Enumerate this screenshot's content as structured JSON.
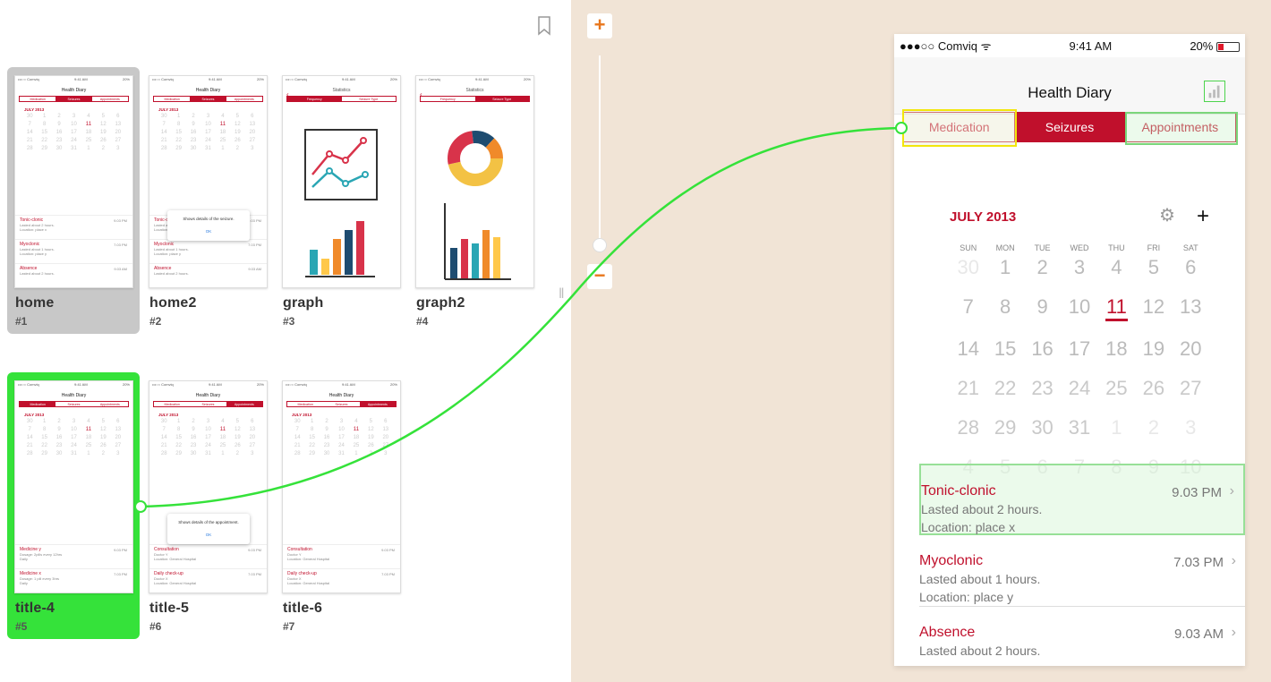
{
  "screens": [
    {
      "title": "home",
      "num": "#1"
    },
    {
      "title": "home2",
      "num": "#2"
    },
    {
      "title": "graph",
      "num": "#3"
    },
    {
      "title": "graph2",
      "num": "#4"
    },
    {
      "title": "title-4",
      "num": "#5"
    },
    {
      "title": "title-5",
      "num": "#6"
    },
    {
      "title": "title-6",
      "num": "#7"
    }
  ],
  "mini": {
    "carrier": "•••○○ Comviq",
    "time": "9:41 AM",
    "battery": "20%",
    "app_title": "Health Diary",
    "stats_title": "Statistics",
    "tabs": [
      "Medication",
      "Seizures",
      "Appointments"
    ],
    "stat_tabs": [
      "Frequency",
      "Seizure Type"
    ],
    "month": "JULY 2013",
    "dialog_seizure": "Shows details of the seizure.",
    "dialog_appt": "Shows details of the appointment.",
    "ok": "OK",
    "seizures": [
      {
        "name": "Tonic-clonic",
        "time": "9.03 PM",
        "l1": "Lasted about 2 hours.",
        "l2": "Location: place x"
      },
      {
        "name": "Myoclonic",
        "time": "7.03 PM",
        "l1": "Lasted about 1 hours.",
        "l2": "Location: place y"
      },
      {
        "name": "Absence",
        "time": "9.03 AM",
        "l1": "Lasted about 2 hours.",
        "l2": ""
      }
    ],
    "medicines": [
      {
        "name": "Medicine y",
        "time": "9.03 PM",
        "l1": "Dosage: 2pills every 12hrs",
        "l2": "Daily"
      },
      {
        "name": "Medicine x",
        "time": "7.03 PM",
        "l1": "Dosage: 1 pill every 3hrs",
        "l2": "Daily"
      }
    ],
    "appointments": [
      {
        "name": "Consultation",
        "time": "9.03 PM",
        "l1": "Doctor Y",
        "l2": "Location: General Hospital"
      },
      {
        "name": "Daily check-up",
        "time": "7.03 PM",
        "l1": "Doctor X",
        "l2": "Location: General Hospital"
      }
    ]
  },
  "zoom": {
    "plus": "+",
    "minus": "−"
  },
  "phone": {
    "carrier": "●●●○○ Comviq",
    "wifi": "ᯤ",
    "time": "9:41 AM",
    "battery": "20%",
    "title": "Health Diary",
    "tabs": [
      "Medication",
      "Seizures",
      "Appointments"
    ],
    "selected_tab": "Seizures",
    "month": "JULY 2013",
    "weekdays": [
      "SUN",
      "MON",
      "TUE",
      "WED",
      "THU",
      "FRI",
      "SAT"
    ],
    "days": [
      "30",
      "1",
      "2",
      "3",
      "4",
      "5",
      "6",
      "7",
      "8",
      "9",
      "10",
      "11",
      "12",
      "13",
      "14",
      "15",
      "16",
      "17",
      "18",
      "19",
      "20",
      "21",
      "22",
      "23",
      "24",
      "25",
      "26",
      "27",
      "28",
      "29",
      "30",
      "31",
      "1",
      "2",
      "3",
      "4",
      "5",
      "6",
      "7",
      "8",
      "9",
      "10"
    ],
    "today": "11",
    "events": [
      {
        "name": "Tonic-clonic",
        "sub1": "Lasted about 2 hours.",
        "sub2": "Location: place x",
        "time": "9.03 PM"
      },
      {
        "name": "Myoclonic",
        "sub1": "Lasted about 1 hours.",
        "sub2": "Location: place y",
        "time": "7.03 PM"
      },
      {
        "name": "Absence",
        "sub1": "Lasted about 2 hours.",
        "sub2": "",
        "time": "9.03 AM"
      }
    ]
  },
  "colors": {
    "accent": "#c0102c",
    "link_line": "#35e23a",
    "canvas": "#f1e4d6",
    "zoom": "#e8761c"
  }
}
